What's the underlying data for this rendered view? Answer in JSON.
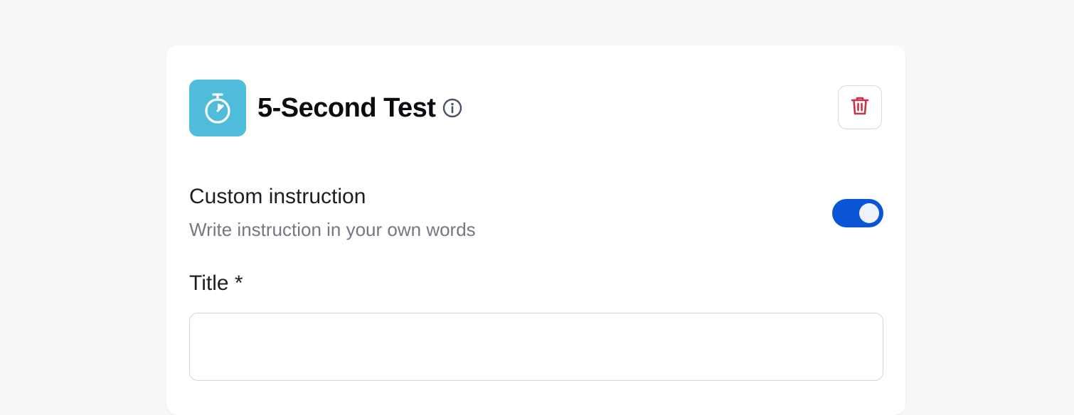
{
  "block": {
    "title": "5-Second Test",
    "icon": "stopwatch-icon",
    "icon_tile_color": "#4fbcd9",
    "info_icon": "info-circle-icon",
    "delete_icon": "trash-icon",
    "delete_icon_color": "#c8324a"
  },
  "custom_instruction": {
    "label": "Custom instruction",
    "description": "Write instruction in your own words",
    "enabled": true,
    "toggle_color": "#0a55d6"
  },
  "title_field": {
    "label": "Title *",
    "value": "",
    "placeholder": ""
  }
}
